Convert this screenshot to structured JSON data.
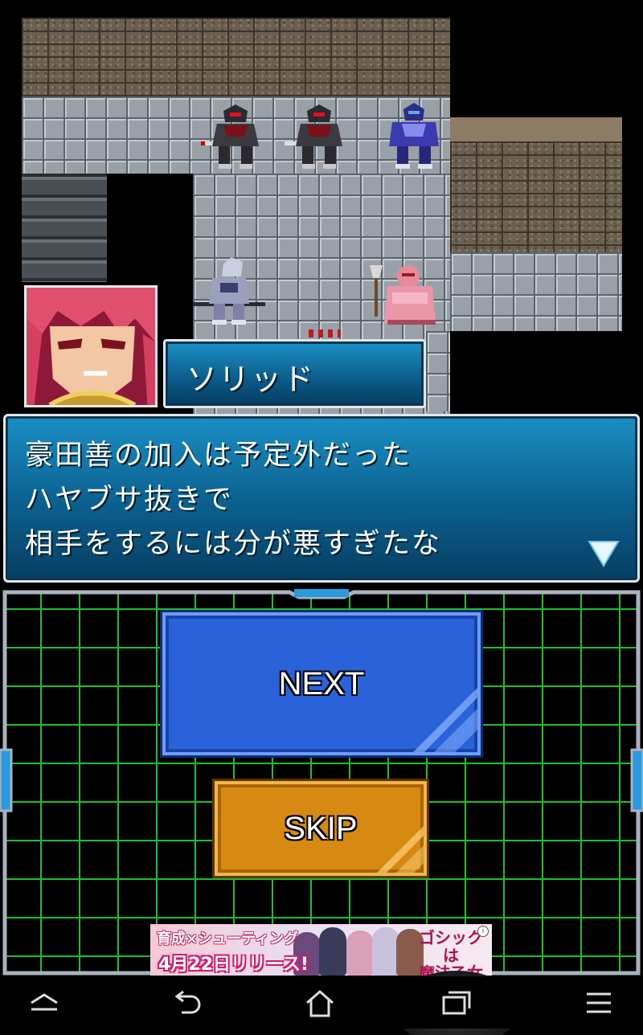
{
  "speaker": {
    "name": "ソリッド"
  },
  "dialogue": {
    "lines": [
      "豪田善の加入は予定外だった",
      "ハヤブサ抜きで",
      "相手をするには分が悪すぎたな"
    ],
    "more_icon": "triangle-down-icon"
  },
  "controls": {
    "next_label": "NEXT",
    "skip_label": "SKIP"
  },
  "ad": {
    "line1": "育成×シューティング",
    "line2": "4月22日リリース!",
    "logo_line1": "ゴシックは",
    "logo_line2": "魔法乙女",
    "info_icon": "info-icon"
  },
  "navbar": {
    "icons": [
      "menu-up-icon",
      "back-icon",
      "home-icon",
      "recents-icon",
      "overflow-menu-icon"
    ]
  },
  "colors": {
    "dialog_blue": "#0b5f8d",
    "grid_green": "#1fbf2a",
    "next_blue": "#2a62d9",
    "skip_orange": "#d68a12"
  }
}
